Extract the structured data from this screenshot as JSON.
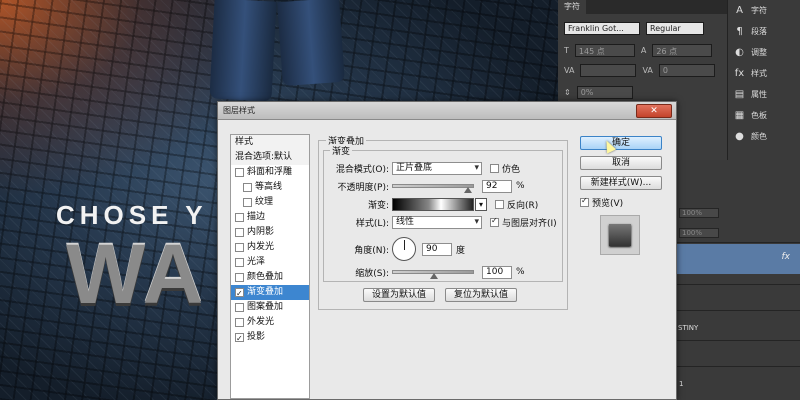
{
  "canvas": {
    "headline": "CHOSE Y",
    "big_word": "WA"
  },
  "char_panel": {
    "tabs": [
      "字符"
    ],
    "font_family": "Franklin Got...",
    "font_style": "Regular",
    "size": "145 点",
    "leading": "26 点",
    "tracking": "0",
    "scale": "0%"
  },
  "side_strip": {
    "items": [
      {
        "icon": "A",
        "label": "字符"
      },
      {
        "icon": "¶",
        "label": "段落"
      },
      {
        "icon": "◐",
        "label": "调整"
      },
      {
        "icon": "fx",
        "label": "样式"
      },
      {
        "icon": "▤",
        "label": "属性"
      },
      {
        "icon": "▦",
        "label": "色板"
      },
      {
        "icon": "●",
        "label": "颜色"
      }
    ]
  },
  "layers": {
    "opacity": "100%",
    "fill": "100%",
    "fx_label": "fx",
    "destiny_label": "STINY",
    "layer_number": "1"
  },
  "dialog": {
    "title": "图层样式",
    "close_label": "✕",
    "style_list": [
      {
        "label": "样式",
        "type": "header"
      },
      {
        "label": "混合选项:默认",
        "type": "header"
      },
      {
        "label": "斜面和浮雕",
        "type": "check",
        "checked": false
      },
      {
        "label": "等高线",
        "type": "check",
        "checked": false,
        "indent": true
      },
      {
        "label": "纹理",
        "type": "check",
        "checked": false,
        "indent": true
      },
      {
        "label": "描边",
        "type": "check",
        "checked": false
      },
      {
        "label": "内阴影",
        "type": "check",
        "checked": false
      },
      {
        "label": "内发光",
        "type": "check",
        "checked": false
      },
      {
        "label": "光泽",
        "type": "check",
        "checked": false
      },
      {
        "label": "颜色叠加",
        "type": "check",
        "checked": false
      },
      {
        "label": "渐变叠加",
        "type": "check",
        "checked": true,
        "selected": true
      },
      {
        "label": "图案叠加",
        "type": "check",
        "checked": false
      },
      {
        "label": "外发光",
        "type": "check",
        "checked": false
      },
      {
        "label": "投影",
        "type": "check",
        "checked": true
      }
    ],
    "group_title": "渐变叠加",
    "inner_title": "渐变",
    "blend_mode_label": "混合模式(O):",
    "blend_mode_value": "正片叠底",
    "dither_label": "仿色",
    "opacity_label": "不透明度(P):",
    "opacity_value": "92",
    "opacity_unit": "%",
    "gradient_label": "渐变:",
    "reverse_label": "反向(R)",
    "style_label": "样式(L):",
    "style_value": "线性",
    "align_label": "与图层对齐(I)",
    "angle_label": "角度(N):",
    "angle_value": "90",
    "angle_unit": "度",
    "scale_label": "缩放(S):",
    "scale_value": "100",
    "scale_unit": "%",
    "make_default_label": "设置为默认值",
    "reset_default_label": "复位为默认值",
    "ok_label": "确定",
    "cancel_label": "取消",
    "new_style_label": "新建样式(W)...",
    "preview_label": "预览(V)",
    "opacity_fraction": 0.92,
    "scale_fraction": 0.5
  }
}
